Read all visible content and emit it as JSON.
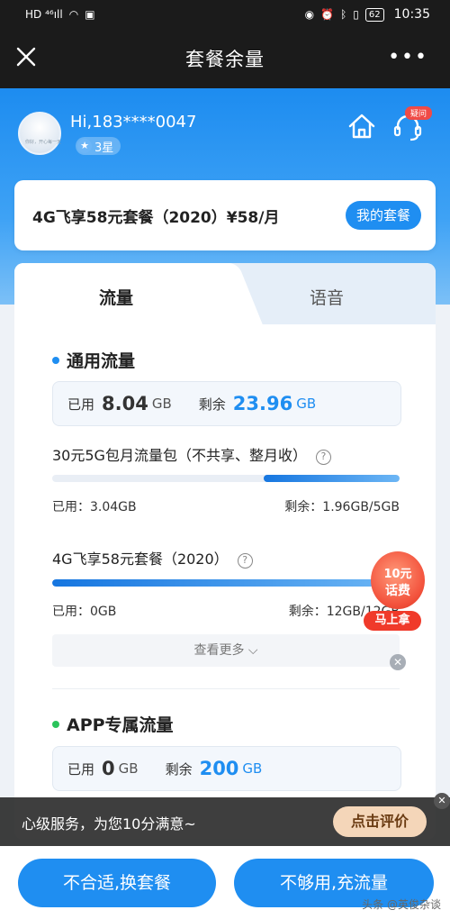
{
  "status_bar": {
    "signal_left": "HD ⁴⁶ıll",
    "battery": "62",
    "time": "10:35"
  },
  "nav": {
    "title": "套餐余量",
    "more": "•••"
  },
  "user": {
    "greeting": "Hi,183****0047",
    "avatar_text": "你好，开心每一天",
    "star_level": "3星",
    "cs_badge": "疑问"
  },
  "plan": {
    "name": "4G飞享58元套餐（2020）¥58/月",
    "button": "我的套餐"
  },
  "tabs": {
    "data": "流量",
    "voice": "语音"
  },
  "general": {
    "title": "通用流量",
    "used_label": "已用",
    "used_value": "8.04",
    "used_unit": "GB",
    "remain_label": "剩余",
    "remain_value": "23.96",
    "remain_unit": "GB"
  },
  "packages": [
    {
      "title": "30元5G包月流量包（不共享、整月收）",
      "used": "已用：3.04GB",
      "remaining": "剩余：1.96GB/5GB",
      "remaining_fraction": 0.392
    },
    {
      "title": "4G飞享58元套餐（2020）",
      "used": "已用：0GB",
      "remaining": "剩余：12GB/12GB",
      "remaining_fraction": 1.0
    }
  ],
  "more": "查看更多",
  "promo": {
    "line1": "10元",
    "line2": "话费",
    "button": "马上拿"
  },
  "app": {
    "title": "APP专属流量",
    "used_label": "已用",
    "used_value": "0",
    "used_unit": "GB",
    "remain_label": "剩余",
    "remain_value": "200",
    "remain_unit": "GB"
  },
  "rate": {
    "text": "心级服务，为您10分满意~",
    "button": "点击评价"
  },
  "footer": {
    "left": "不合适,换套餐",
    "right": "不够用,充流量",
    "watermark": "头条 @英俊杂谈"
  },
  "colors": {
    "primary": "#1f8ef1",
    "dot_blue": "#1f8ef1",
    "dot_green": "#2bc35b",
    "promo_red": "#f03a2a"
  }
}
